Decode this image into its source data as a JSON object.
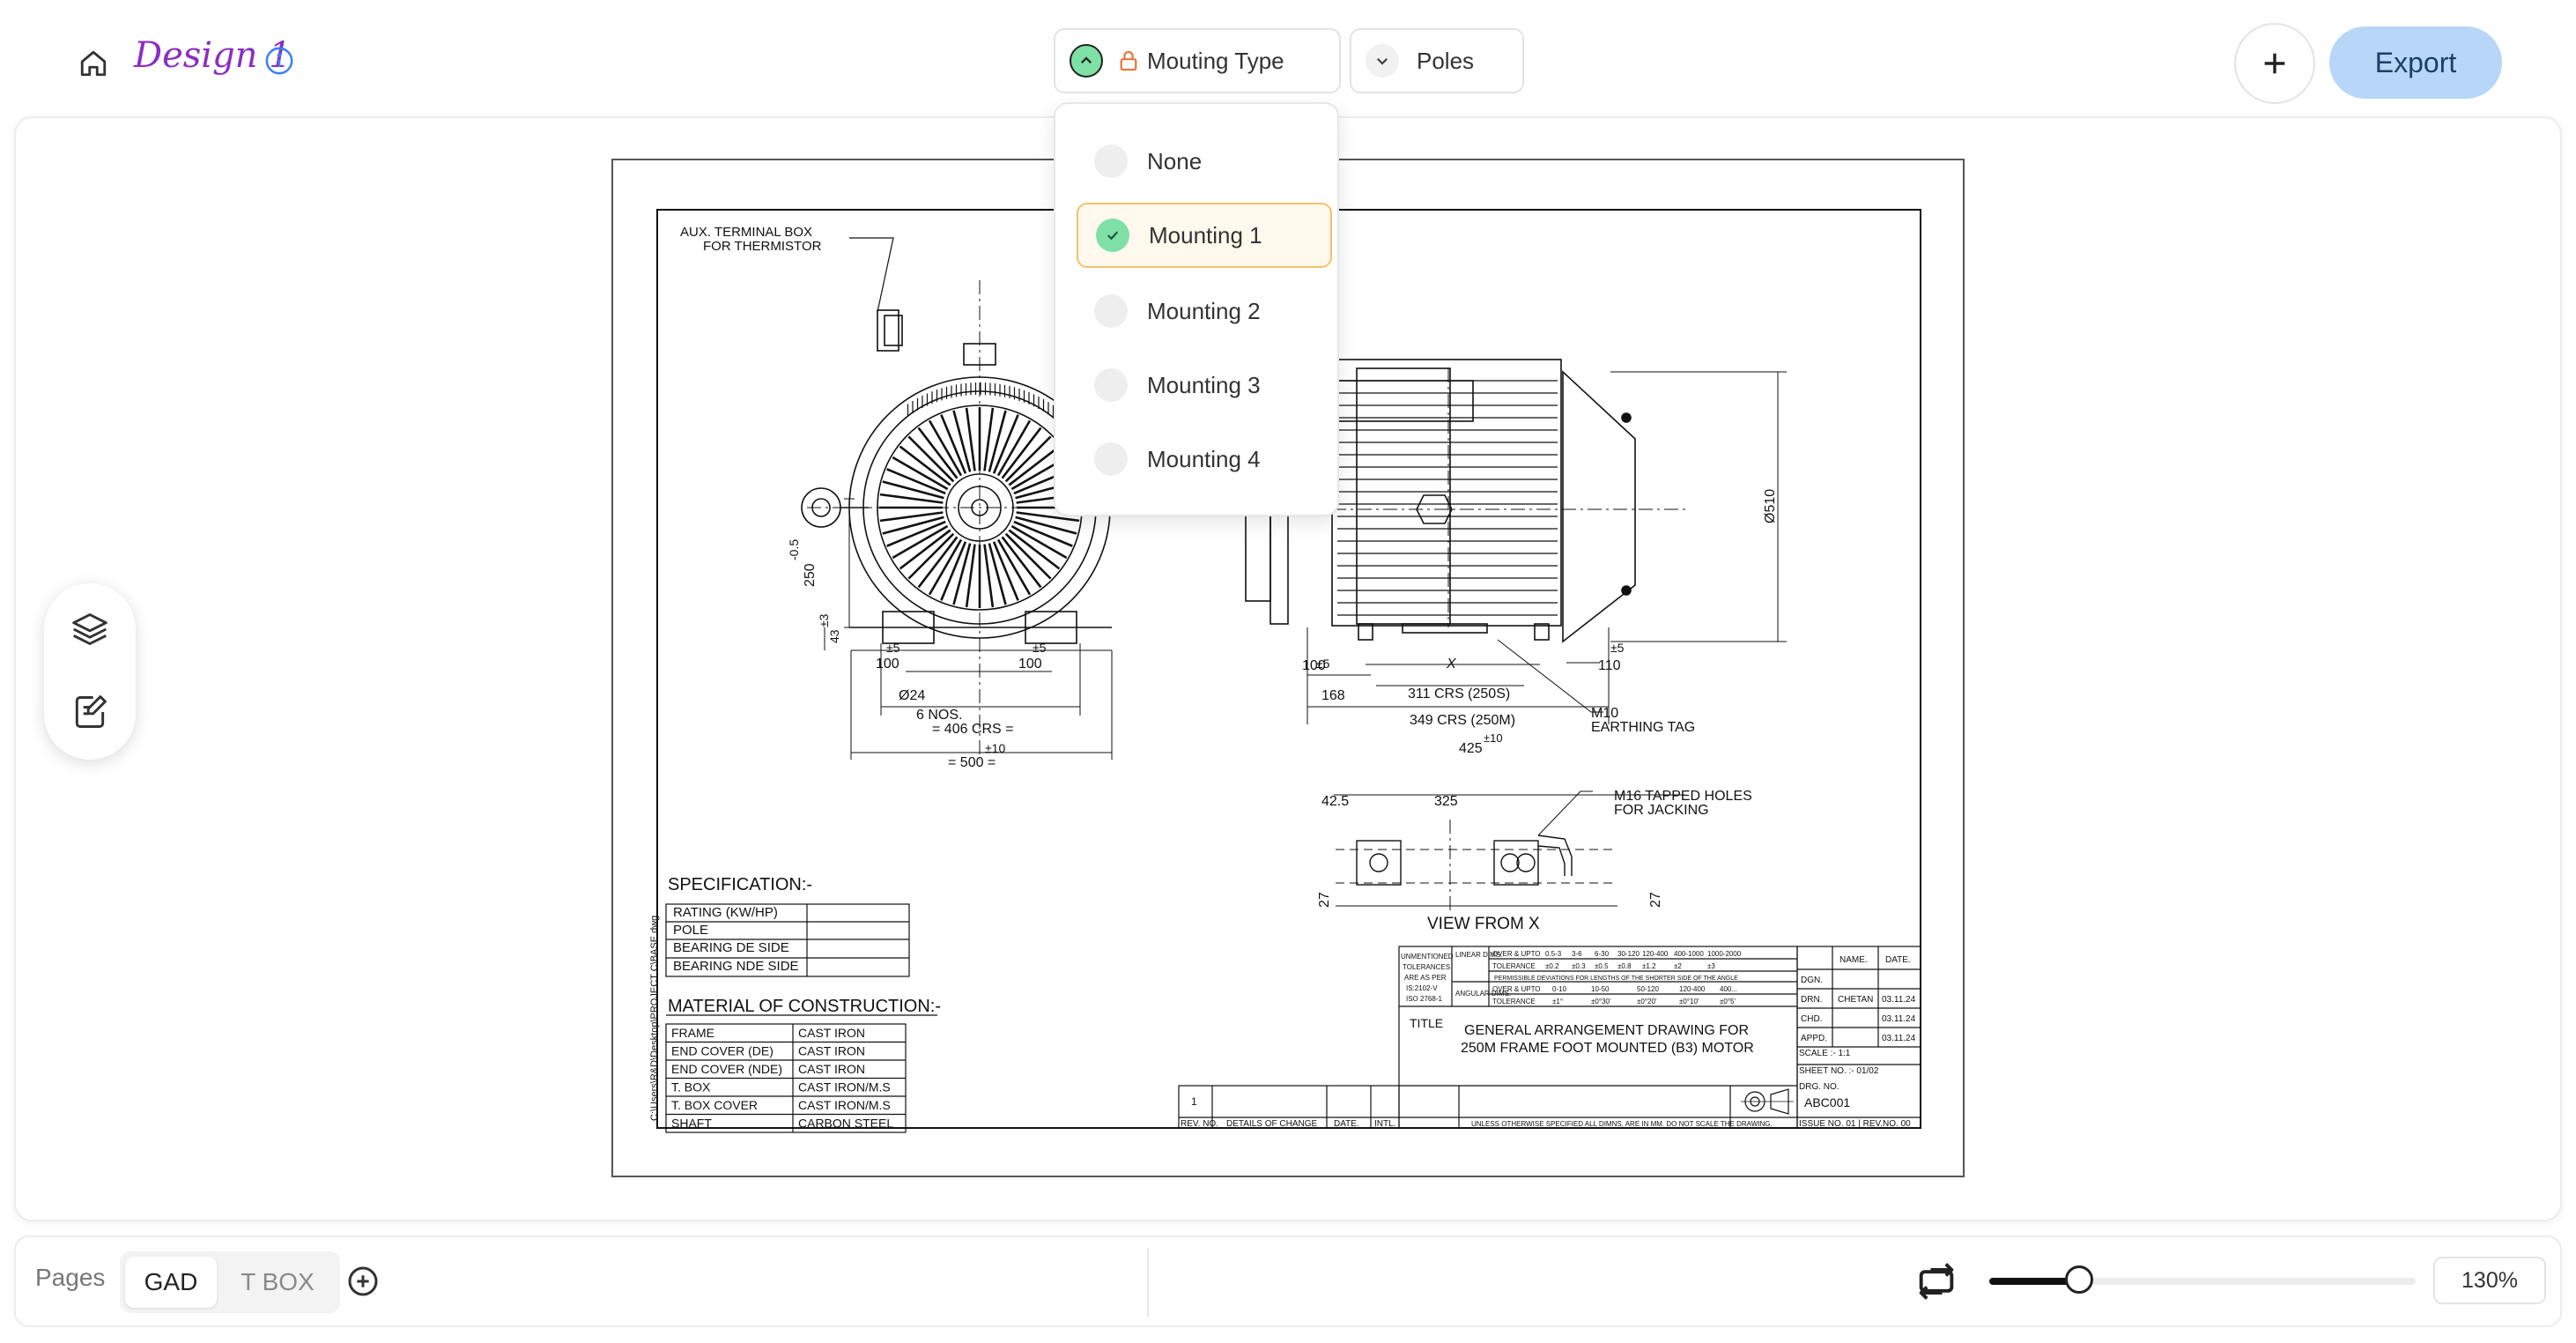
{
  "header": {
    "title": "Design 1",
    "mounting_label": "Mouting Type",
    "poles_label": "Poles",
    "export_label": "Export"
  },
  "dropdown": {
    "options": [
      "None",
      "Mounting 1",
      "Mounting 2",
      "Mounting 3",
      "Mounting 4"
    ],
    "selected": "Mounting 1"
  },
  "drawing": {
    "aux_box_note": [
      "AUX. TERMINAL BOX",
      "FOR THERMISTOR"
    ],
    "dims": {
      "d_0_5": "-0.5",
      "d_250": "250",
      "d_pm3": "±3",
      "d_43": "43",
      "d_pm5a": "±5",
      "d_100a": "100",
      "d_pm5b": "±5",
      "d_100b": "100",
      "d_phi24": "Ø24",
      "d_6nos": "6 NOS.",
      "d_406": "= 406 CRS =",
      "d_pm10a": "±10",
      "d_500": "= 500 =",
      "d_pm5c": "±5",
      "d_100c": "100",
      "d_168": "168",
      "d_311": "311 CRS (250S)",
      "d_349": "349 CRS (250M)",
      "d_425": "425",
      "d_pm10b": "±10",
      "d_pm5d": "±5",
      "d_110": "110",
      "d_phi510": "Ø510",
      "d_x": "X",
      "m10": "M10",
      "earthing": "EARTHING TAG",
      "d_42_5": "42.5",
      "d_325": "325",
      "d_27a": "27",
      "d_27b": "27",
      "m16a": "M16 TAPPED HOLES",
      "m16b": "FOR JACKING",
      "view_from": "VIEW FROM X"
    },
    "spec_title": "SPECIFICATION:-",
    "spec_rows": [
      "RATING (KW/HP)",
      "POLE",
      "BEARING DE SIDE",
      "BEARING NDE SIDE"
    ],
    "moc_title": "MATERIAL OF CONSTRUCTION:-",
    "moc_rows": [
      [
        "FRAME",
        "CAST IRON"
      ],
      [
        "END COVER (DE)",
        "CAST IRON"
      ],
      [
        "END COVER (NDE)",
        "CAST IRON"
      ],
      [
        "T. BOX",
        "CAST IRON/M.S"
      ],
      [
        "T. BOX COVER",
        "CAST IRON/M.S"
      ],
      [
        "SHAFT",
        "CARBON STEEL"
      ]
    ],
    "path_text": "C:\\Users\\R&D\\Desktop\\PROJECT C\\BASE.dwg",
    "title_label": "TITLE",
    "title_lines": [
      "GENERAL ARRANGEMENT DRAWING FOR",
      "250M FRAME FOOT MOUNTED (B3) MOTOR"
    ],
    "tolerance": {
      "left": [
        "UNMENTIONED",
        "TOLERANCES",
        "ARE AS PER",
        "IS:2102-V",
        "ISO 2768-1"
      ],
      "linear": "LINEAR DIMS.",
      "angular": "ANGULAR DIMS.",
      "over_upto": "OVER & UPTO",
      "tol": "TOLERANCE",
      "lin_ranges": [
        "0.5-3",
        "3-6",
        "6-30",
        "30-120",
        "120-400",
        "400-1000",
        "1000-2000"
      ],
      "lin_tols": [
        "±0.2",
        "±0.3",
        "±0.5",
        "±0.8",
        "±1.2",
        "±2",
        "±3"
      ],
      "note": "PERMISSIBLE DEVIATIONS FOR LENGTHS OF THE SHORTER SIDE OF THE ANGLE",
      "ang_ranges": [
        "0-10",
        "10-50",
        "50-120",
        "120-400",
        "400..."
      ],
      "ang_tols": [
        "±1°",
        "±0°30'",
        "±0°20'",
        "±0°10'",
        "±0°5'"
      ]
    },
    "block": {
      "name_hdr": "NAME.",
      "date_hdr": "DATE.",
      "rows": [
        [
          "DGN.",
          "",
          ""
        ],
        [
          "DRN.",
          "CHETAN",
          "03.11.24"
        ],
        [
          "CHD.",
          "",
          "03.11.24"
        ],
        [
          "APPD.",
          "",
          "03.11.24"
        ]
      ],
      "scale": "SCALE :- 1:1",
      "sheet": "SHEET NO. :- 01/02",
      "drg_label": "DRG. NO.",
      "drg_no": "ABC001",
      "issue": "ISSUE NO. 01 | REV.NO. 00"
    },
    "rev": {
      "num": "1",
      "cols": [
        "REV. NO.",
        "DETAILS OF CHANGE",
        "DATE.",
        "INTL."
      ]
    },
    "footnote": "UNLESS OTHERWISE SPECIFIED ALL DIMNS. ARE IN MM.   DO NOT SCALE THE DRAWING."
  },
  "footer": {
    "pages_label": "Pages",
    "tabs": [
      "GAD",
      "T BOX"
    ],
    "zoom_value": "130%",
    "zoom_fraction": 0.21
  }
}
